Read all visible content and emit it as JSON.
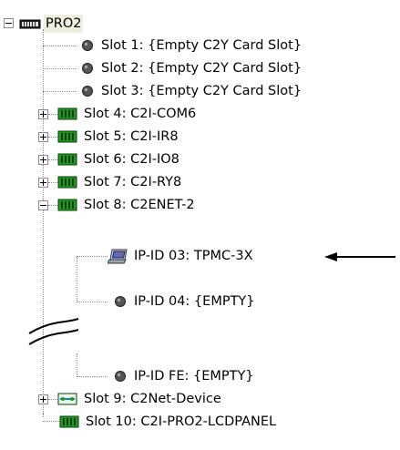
{
  "tree": {
    "root": {
      "label": "PRO2",
      "expanded": true,
      "icon": "chassis-icon"
    },
    "slots": [
      {
        "label": "Slot 1: {Empty C2Y Card Slot}",
        "icon": "empty-slot-icon",
        "expandable": false
      },
      {
        "label": "Slot 2: {Empty C2Y Card Slot}",
        "icon": "empty-slot-icon",
        "expandable": false
      },
      {
        "label": "Slot 3: {Empty C2Y Card Slot}",
        "icon": "empty-slot-icon",
        "expandable": false
      },
      {
        "label": "Slot 4: C2I-COM6",
        "icon": "card-icon",
        "expandable": true,
        "expanded": false
      },
      {
        "label": "Slot 5: C2I-IR8",
        "icon": "card-icon",
        "expandable": true,
        "expanded": false
      },
      {
        "label": "Slot 6: C2I-IO8",
        "icon": "card-icon",
        "expandable": true,
        "expanded": false
      },
      {
        "label": "Slot 7: C2I-RY8",
        "icon": "card-icon",
        "expandable": true,
        "expanded": false
      },
      {
        "label": "Slot 8: C2ENET-2",
        "icon": "card-icon",
        "expandable": true,
        "expanded": true,
        "children": [
          {
            "label": "IP-ID 03: TPMC-3X",
            "icon": "touchpanel-icon"
          },
          {
            "label": "IP-ID 04: {EMPTY}",
            "icon": "empty-slot-icon"
          },
          {
            "label": "IP-ID FE: {EMPTY}",
            "icon": "empty-slot-icon"
          }
        ]
      },
      {
        "label": "Slot 9: C2Net-Device",
        "icon": "network-device-icon",
        "expandable": true,
        "expanded": false
      },
      {
        "label": "Slot 10: C2I-PRO2-LCDPANEL",
        "icon": "card-icon",
        "expandable": false
      }
    ]
  },
  "colors": {
    "card_green": "#1f9a1f",
    "card_dark": "#0b3d0b",
    "empty_dot": "#555555",
    "root_highlight": "#efefdf"
  }
}
